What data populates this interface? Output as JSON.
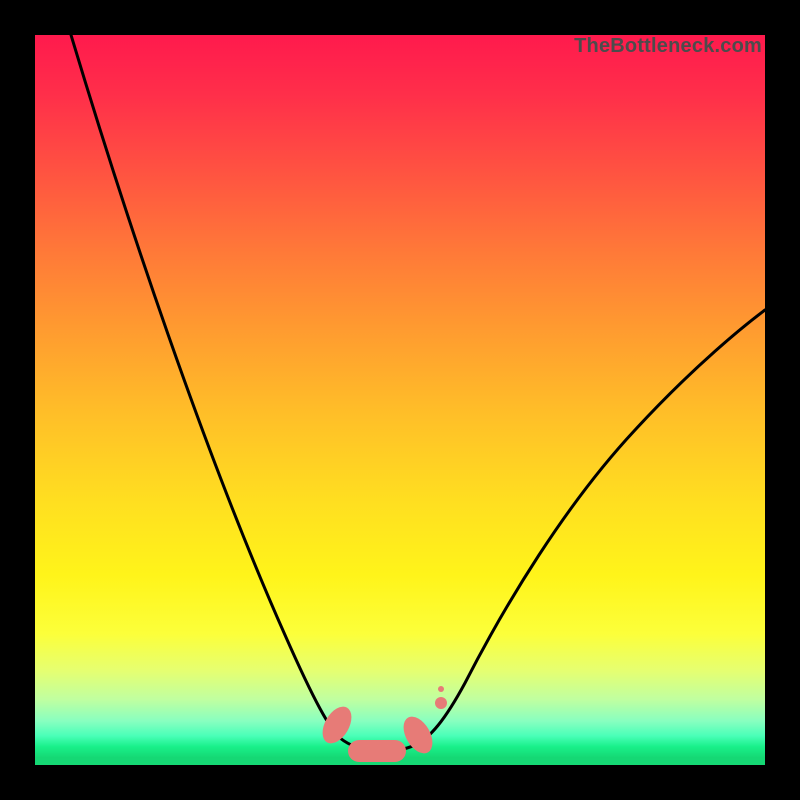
{
  "watermark": "TheBottleneck.com",
  "chart_data": {
    "type": "line",
    "title": "",
    "xlabel": "",
    "ylabel": "",
    "xlim": [
      0,
      100
    ],
    "ylim": [
      0,
      100
    ],
    "series": [
      {
        "name": "bottleneck-curve",
        "x": [
          5,
          10,
          15,
          20,
          25,
          30,
          35,
          38,
          40,
          42,
          44,
          46,
          48,
          50,
          52,
          54,
          56,
          60,
          65,
          70,
          75,
          80,
          85,
          90,
          95,
          100
        ],
        "values": [
          100,
          86,
          72,
          58,
          45,
          33,
          22,
          14,
          9,
          5,
          2,
          1,
          0.7,
          0.7,
          0.7,
          2,
          5,
          12,
          21,
          30,
          39,
          47,
          54,
          59,
          62,
          64
        ]
      }
    ],
    "markers": [
      {
        "name": "marker-a",
        "x": 41,
        "y": 5,
        "shape": "pill"
      },
      {
        "name": "marker-b",
        "x": 47,
        "y": 1,
        "shape": "wide-pill"
      },
      {
        "name": "marker-c",
        "x": 53,
        "y": 4,
        "shape": "pill"
      },
      {
        "name": "marker-d",
        "x": 55,
        "y": 9,
        "shape": "dot"
      }
    ],
    "colors": {
      "curve": "#000000",
      "marker_fill": "#e77b77",
      "gradient_top": "#ff1a4d",
      "gradient_bottom": "#15d874"
    }
  }
}
